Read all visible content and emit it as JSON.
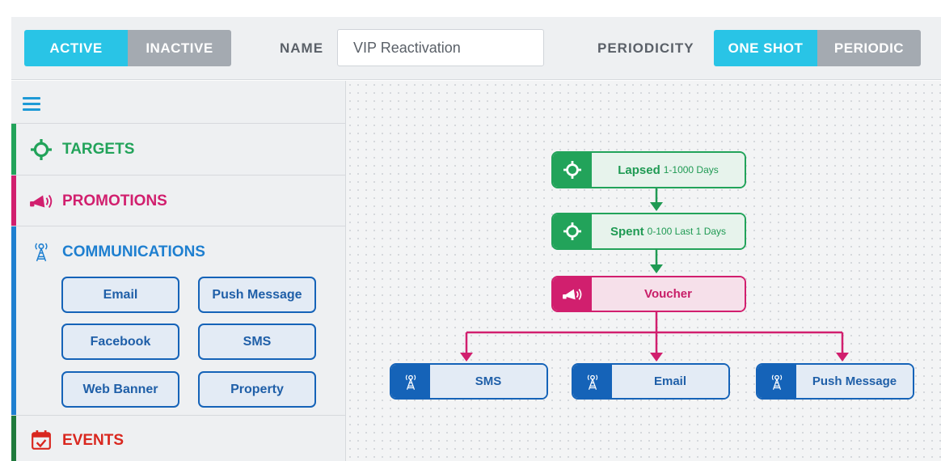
{
  "header": {
    "status_toggle": {
      "active_label": "ACTIVE",
      "inactive_label": "INACTIVE",
      "selected": "ACTIVE"
    },
    "name_label": "NAME",
    "name_value": "VIP Reactivation",
    "periodicity_label": "PERIODICITY",
    "periodicity_toggle": {
      "one_shot_label": "ONE SHOT",
      "periodic_label": "PERIODIC",
      "selected": "ONE SHOT"
    }
  },
  "sidebar": {
    "menu_icon": "hamburger-menu-icon",
    "targets": {
      "label": "TARGETS",
      "icon": "crosshair-icon",
      "color": "#22a35a"
    },
    "promotions": {
      "label": "PROMOTIONS",
      "icon": "megaphone-icon",
      "color": "#d11f6e"
    },
    "communications": {
      "label": "COMMUNICATIONS",
      "icon": "antenna-tower-icon",
      "color": "#1e7fd0",
      "buttons": [
        "Email",
        "Push Message",
        "Facebook",
        "SMS",
        "Web Banner",
        "Property"
      ]
    },
    "events": {
      "label": "EVENTS",
      "icon": "calendar-check-icon",
      "color": "#d9271f"
    }
  },
  "flow": {
    "nodes": [
      {
        "kind": "target",
        "label": "Lapsed",
        "detail": "1-1000 Days",
        "icon": "crosshair-icon"
      },
      {
        "kind": "target",
        "label": "Spent",
        "detail": "0-100 Last 1 Days",
        "icon": "crosshair-icon"
      },
      {
        "kind": "promotion",
        "label": "Voucher",
        "detail": "",
        "icon": "megaphone-icon"
      },
      {
        "kind": "communication",
        "label": "SMS",
        "detail": "",
        "icon": "antenna-tower-icon"
      },
      {
        "kind": "communication",
        "label": "Email",
        "detail": "",
        "icon": "antenna-tower-icon"
      },
      {
        "kind": "communication",
        "label": "Push Message",
        "detail": "",
        "icon": "antenna-tower-icon"
      }
    ],
    "colors": {
      "target": "#22a35a",
      "promotion": "#d11f6e",
      "communication": "#1563b8"
    }
  }
}
